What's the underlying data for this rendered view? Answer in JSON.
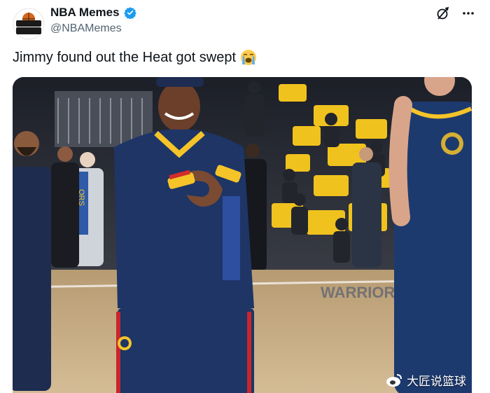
{
  "tweet": {
    "display_name": "NBA Memes",
    "handle": "@NBAMemes",
    "avatar_text": "NBA MEMES",
    "text": "Jimmy found out the Heat got swept",
    "emoji": "loudly-crying-face"
  },
  "icons": {
    "verified": "verified-badge-icon",
    "grok": "grok-icon",
    "more": "more-options-icon"
  },
  "media": {
    "watermark_text": "大匠说篮球",
    "court_text": "WARRIORS",
    "sign_text": "ORS"
  },
  "colors": {
    "verified_blue": "#1d9bf0",
    "warriors_navy": "#1d3a6e",
    "warriors_gold": "#f5c428",
    "seat_yellow": "#f0c21e"
  }
}
